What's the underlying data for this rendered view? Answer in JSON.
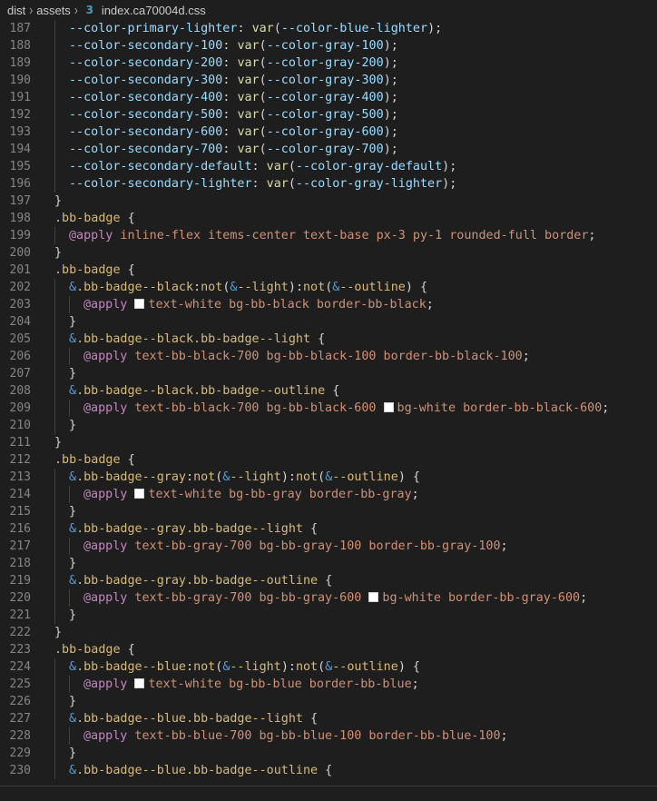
{
  "breadcrumb": [
    "dist",
    "assets",
    "index.ca70004d.css"
  ],
  "icons": {
    "separator": "chevron-right-icon",
    "file": "css-file-icon"
  },
  "lines": [
    {
      "n": "187",
      "indent": 1,
      "tokens": [
        [
          "prop",
          "--color-primary-lighter"
        ],
        [
          "punc",
          ": "
        ],
        [
          "fn",
          "var"
        ],
        [
          "punc",
          "("
        ],
        [
          "prop",
          "--color-blue-lighter"
        ],
        [
          "punc",
          ");"
        ]
      ]
    },
    {
      "n": "188",
      "indent": 1,
      "tokens": [
        [
          "prop",
          "--color-secondary-100"
        ],
        [
          "punc",
          ": "
        ],
        [
          "fn",
          "var"
        ],
        [
          "punc",
          "("
        ],
        [
          "prop",
          "--color-gray-100"
        ],
        [
          "punc",
          ");"
        ]
      ]
    },
    {
      "n": "189",
      "indent": 1,
      "tokens": [
        [
          "prop",
          "--color-secondary-200"
        ],
        [
          "punc",
          ": "
        ],
        [
          "fn",
          "var"
        ],
        [
          "punc",
          "("
        ],
        [
          "prop",
          "--color-gray-200"
        ],
        [
          "punc",
          ");"
        ]
      ]
    },
    {
      "n": "190",
      "indent": 1,
      "tokens": [
        [
          "prop",
          "--color-secondary-300"
        ],
        [
          "punc",
          ": "
        ],
        [
          "fn",
          "var"
        ],
        [
          "punc",
          "("
        ],
        [
          "prop",
          "--color-gray-300"
        ],
        [
          "punc",
          ");"
        ]
      ]
    },
    {
      "n": "191",
      "indent": 1,
      "tokens": [
        [
          "prop",
          "--color-secondary-400"
        ],
        [
          "punc",
          ": "
        ],
        [
          "fn",
          "var"
        ],
        [
          "punc",
          "("
        ],
        [
          "prop",
          "--color-gray-400"
        ],
        [
          "punc",
          ");"
        ]
      ]
    },
    {
      "n": "192",
      "indent": 1,
      "tokens": [
        [
          "prop",
          "--color-secondary-500"
        ],
        [
          "punc",
          ": "
        ],
        [
          "fn",
          "var"
        ],
        [
          "punc",
          "("
        ],
        [
          "prop",
          "--color-gray-500"
        ],
        [
          "punc",
          ");"
        ]
      ]
    },
    {
      "n": "193",
      "indent": 1,
      "tokens": [
        [
          "prop",
          "--color-secondary-600"
        ],
        [
          "punc",
          ": "
        ],
        [
          "fn",
          "var"
        ],
        [
          "punc",
          "("
        ],
        [
          "prop",
          "--color-gray-600"
        ],
        [
          "punc",
          ");"
        ]
      ]
    },
    {
      "n": "194",
      "indent": 1,
      "tokens": [
        [
          "prop",
          "--color-secondary-700"
        ],
        [
          "punc",
          ": "
        ],
        [
          "fn",
          "var"
        ],
        [
          "punc",
          "("
        ],
        [
          "prop",
          "--color-gray-700"
        ],
        [
          "punc",
          ");"
        ]
      ]
    },
    {
      "n": "195",
      "indent": 1,
      "tokens": [
        [
          "prop",
          "--color-secondary-default"
        ],
        [
          "punc",
          ": "
        ],
        [
          "fn",
          "var"
        ],
        [
          "punc",
          "("
        ],
        [
          "prop",
          "--color-gray-default"
        ],
        [
          "punc",
          ");"
        ]
      ]
    },
    {
      "n": "196",
      "indent": 1,
      "tokens": [
        [
          "prop",
          "--color-secondary-lighter"
        ],
        [
          "punc",
          ": "
        ],
        [
          "fn",
          "var"
        ],
        [
          "punc",
          "("
        ],
        [
          "prop",
          "--color-gray-lighter"
        ],
        [
          "punc",
          ");"
        ]
      ]
    },
    {
      "n": "197",
      "indent": 0,
      "tokens": [
        [
          "punc",
          "}"
        ]
      ]
    },
    {
      "n": "198",
      "indent": 0,
      "tokens": [
        [
          "sel",
          ".bb-badge"
        ],
        [
          "punc",
          " {"
        ]
      ]
    },
    {
      "n": "199",
      "indent": 1,
      "tokens": [
        [
          "kw",
          "@apply"
        ],
        [
          "val",
          " inline-flex items-center text-base px-3 py-1 rounded-full border"
        ],
        [
          "punc",
          ";"
        ]
      ]
    },
    {
      "n": "200",
      "indent": 0,
      "tokens": [
        [
          "punc",
          "}"
        ]
      ]
    },
    {
      "n": "201",
      "indent": 0,
      "tokens": [
        [
          "sel",
          ".bb-badge"
        ],
        [
          "punc",
          " {"
        ]
      ]
    },
    {
      "n": "202",
      "indent": 1,
      "tokens": [
        [
          "blue",
          "&"
        ],
        [
          "sel",
          ".bb-badge--black"
        ],
        [
          "punc",
          ":"
        ],
        [
          "sel",
          "not"
        ],
        [
          "punc",
          "("
        ],
        [
          "blue",
          "&"
        ],
        [
          "sel",
          "--light"
        ],
        [
          "punc",
          ")"
        ],
        [
          "punc",
          ":"
        ],
        [
          "sel",
          "not"
        ],
        [
          "punc",
          "("
        ],
        [
          "blue",
          "&"
        ],
        [
          "sel",
          "--outline"
        ],
        [
          "punc",
          ") {"
        ]
      ]
    },
    {
      "n": "203",
      "indent": 2,
      "tokens": [
        [
          "kw",
          "@apply"
        ],
        [
          "punc",
          " "
        ],
        [
          "swatch",
          ""
        ],
        [
          "val",
          "text-white bg-bb-black border-bb-black"
        ],
        [
          "punc",
          ";"
        ]
      ]
    },
    {
      "n": "204",
      "indent": 1,
      "tokens": [
        [
          "punc",
          "}"
        ]
      ]
    },
    {
      "n": "205",
      "indent": 1,
      "tokens": [
        [
          "blue",
          "&"
        ],
        [
          "sel",
          ".bb-badge--black.bb-badge--light"
        ],
        [
          "punc",
          " {"
        ]
      ]
    },
    {
      "n": "206",
      "indent": 2,
      "tokens": [
        [
          "kw",
          "@apply"
        ],
        [
          "val",
          " text-bb-black-700 bg-bb-black-100 border-bb-black-100"
        ],
        [
          "punc",
          ";"
        ]
      ]
    },
    {
      "n": "207",
      "indent": 1,
      "tokens": [
        [
          "punc",
          "}"
        ]
      ]
    },
    {
      "n": "208",
      "indent": 1,
      "tokens": [
        [
          "blue",
          "&"
        ],
        [
          "sel",
          ".bb-badge--black.bb-badge--outline"
        ],
        [
          "punc",
          " {"
        ]
      ]
    },
    {
      "n": "209",
      "indent": 2,
      "tokens": [
        [
          "kw",
          "@apply"
        ],
        [
          "val",
          " text-bb-black-700 bg-bb-black-600 "
        ],
        [
          "swatch",
          ""
        ],
        [
          "val",
          "bg-white border-bb-black-600"
        ],
        [
          "punc",
          ";"
        ]
      ]
    },
    {
      "n": "210",
      "indent": 1,
      "tokens": [
        [
          "punc",
          "}"
        ]
      ]
    },
    {
      "n": "211",
      "indent": 0,
      "tokens": [
        [
          "punc",
          "}"
        ]
      ]
    },
    {
      "n": "212",
      "indent": 0,
      "tokens": [
        [
          "sel",
          ".bb-badge"
        ],
        [
          "punc",
          " {"
        ]
      ]
    },
    {
      "n": "213",
      "indent": 1,
      "tokens": [
        [
          "blue",
          "&"
        ],
        [
          "sel",
          ".bb-badge--gray"
        ],
        [
          "punc",
          ":"
        ],
        [
          "sel",
          "not"
        ],
        [
          "punc",
          "("
        ],
        [
          "blue",
          "&"
        ],
        [
          "sel",
          "--light"
        ],
        [
          "punc",
          ")"
        ],
        [
          "punc",
          ":"
        ],
        [
          "sel",
          "not"
        ],
        [
          "punc",
          "("
        ],
        [
          "blue",
          "&"
        ],
        [
          "sel",
          "--outline"
        ],
        [
          "punc",
          ") {"
        ]
      ]
    },
    {
      "n": "214",
      "indent": 2,
      "tokens": [
        [
          "kw",
          "@apply"
        ],
        [
          "punc",
          " "
        ],
        [
          "swatch",
          ""
        ],
        [
          "val",
          "text-white bg-bb-gray border-bb-gray"
        ],
        [
          "punc",
          ";"
        ]
      ]
    },
    {
      "n": "215",
      "indent": 1,
      "tokens": [
        [
          "punc",
          "}"
        ]
      ]
    },
    {
      "n": "216",
      "indent": 1,
      "tokens": [
        [
          "blue",
          "&"
        ],
        [
          "sel",
          ".bb-badge--gray.bb-badge--light"
        ],
        [
          "punc",
          " {"
        ]
      ]
    },
    {
      "n": "217",
      "indent": 2,
      "tokens": [
        [
          "kw",
          "@apply"
        ],
        [
          "val",
          " text-bb-gray-700 bg-bb-gray-100 border-bb-gray-100"
        ],
        [
          "punc",
          ";"
        ]
      ]
    },
    {
      "n": "218",
      "indent": 1,
      "tokens": [
        [
          "punc",
          "}"
        ]
      ]
    },
    {
      "n": "219",
      "indent": 1,
      "tokens": [
        [
          "blue",
          "&"
        ],
        [
          "sel",
          ".bb-badge--gray.bb-badge--outline"
        ],
        [
          "punc",
          " {"
        ]
      ]
    },
    {
      "n": "220",
      "indent": 2,
      "tokens": [
        [
          "kw",
          "@apply"
        ],
        [
          "val",
          " text-bb-gray-700 bg-bb-gray-600 "
        ],
        [
          "swatch",
          ""
        ],
        [
          "val",
          "bg-white border-bb-gray-600"
        ],
        [
          "punc",
          ";"
        ]
      ]
    },
    {
      "n": "221",
      "indent": 1,
      "tokens": [
        [
          "punc",
          "}"
        ]
      ]
    },
    {
      "n": "222",
      "indent": 0,
      "tokens": [
        [
          "punc",
          "}"
        ]
      ]
    },
    {
      "n": "223",
      "indent": 0,
      "tokens": [
        [
          "sel",
          ".bb-badge"
        ],
        [
          "punc",
          " {"
        ]
      ]
    },
    {
      "n": "224",
      "indent": 1,
      "tokens": [
        [
          "blue",
          "&"
        ],
        [
          "sel",
          ".bb-badge--blue"
        ],
        [
          "punc",
          ":"
        ],
        [
          "sel",
          "not"
        ],
        [
          "punc",
          "("
        ],
        [
          "blue",
          "&"
        ],
        [
          "sel",
          "--light"
        ],
        [
          "punc",
          ")"
        ],
        [
          "punc",
          ":"
        ],
        [
          "sel",
          "not"
        ],
        [
          "punc",
          "("
        ],
        [
          "blue",
          "&"
        ],
        [
          "sel",
          "--outline"
        ],
        [
          "punc",
          ") {"
        ]
      ]
    },
    {
      "n": "225",
      "indent": 2,
      "tokens": [
        [
          "kw",
          "@apply"
        ],
        [
          "punc",
          " "
        ],
        [
          "swatch",
          ""
        ],
        [
          "val",
          "text-white bg-bb-blue border-bb-blue"
        ],
        [
          "punc",
          ";"
        ]
      ]
    },
    {
      "n": "226",
      "indent": 1,
      "tokens": [
        [
          "punc",
          "}"
        ]
      ]
    },
    {
      "n": "227",
      "indent": 1,
      "tokens": [
        [
          "blue",
          "&"
        ],
        [
          "sel",
          ".bb-badge--blue.bb-badge--light"
        ],
        [
          "punc",
          " {"
        ]
      ]
    },
    {
      "n": "228",
      "indent": 2,
      "tokens": [
        [
          "kw",
          "@apply"
        ],
        [
          "val",
          " text-bb-blue-700 bg-bb-blue-100 border-bb-blue-100"
        ],
        [
          "punc",
          ";"
        ]
      ]
    },
    {
      "n": "229",
      "indent": 1,
      "tokens": [
        [
          "punc",
          "}"
        ]
      ]
    },
    {
      "n": "230",
      "indent": 1,
      "tokens": [
        [
          "blue",
          "&"
        ],
        [
          "sel",
          ".bb-badge--blue.bb-badge--outline"
        ],
        [
          "punc",
          " {"
        ]
      ]
    }
  ],
  "colors": {
    "background": "#1e1e1e",
    "line_number": "#858585",
    "property": "#9cdcfe",
    "function": "#dcdcaa",
    "selector": "#d7ba7d",
    "keyword": "#c586c0",
    "value": "#ce9178",
    "ampersand": "#569cd6"
  }
}
